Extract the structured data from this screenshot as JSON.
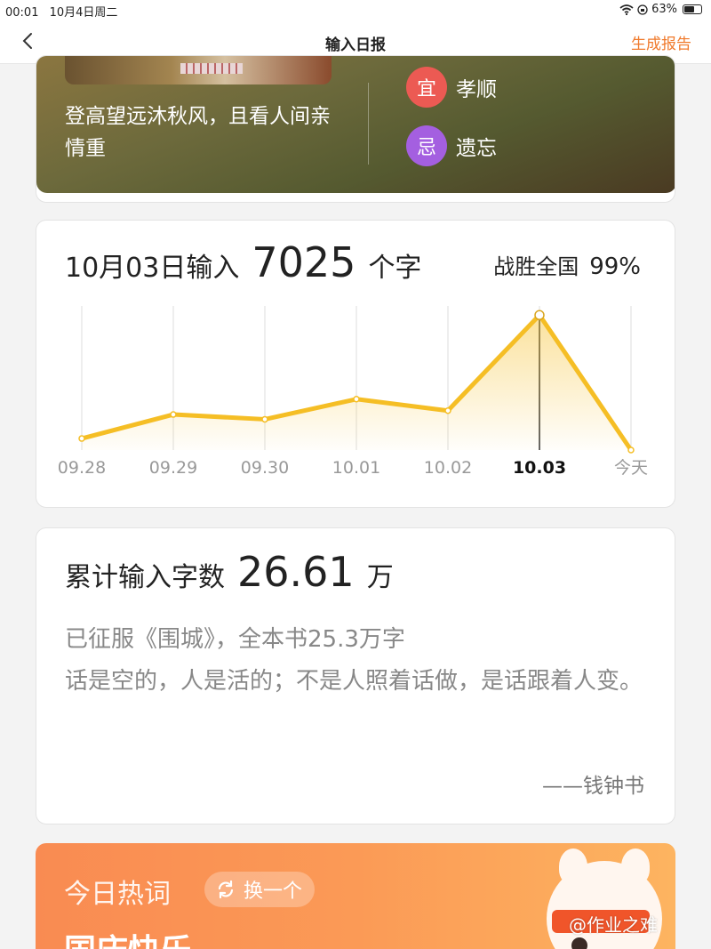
{
  "status_bar": {
    "time": "00:01",
    "date": "10月4日周二",
    "battery": "63%",
    "battery_level": 0.63
  },
  "nav": {
    "title": "输入日报",
    "action": "生成报告"
  },
  "banner": {
    "poem": "登高望远沐秋风，且看人间亲情重",
    "good_label": "宜",
    "good_value": "孝顺",
    "bad_label": "忌",
    "bad_value": "遗忘"
  },
  "daily": {
    "date_prefix": "10月03日输入",
    "count": "7025",
    "unit": "个字",
    "rank_label": "战胜全国",
    "rank_value": "99%"
  },
  "chart_data": {
    "type": "area",
    "categories": [
      "09.28",
      "09.29",
      "09.30",
      "10.01",
      "10.02",
      "10.03",
      "今天"
    ],
    "values": [
      600,
      1850,
      1600,
      2650,
      2050,
      7025,
      0
    ],
    "selected_index": 5,
    "ylim": [
      0,
      7500
    ],
    "grid": "vertical",
    "line_color": "#f5be25",
    "title": "",
    "xlabel": "",
    "ylabel": ""
  },
  "total": {
    "label": "累计输入字数",
    "value": "26.61",
    "unit": "万",
    "conquered": "已征服《围城》，全本书25.3万字",
    "quote": "话是空的，人是活的；不是人照着话做，是话跟着人变。",
    "author": "——钱钟书"
  },
  "hot": {
    "label": "今日热词",
    "refresh": "换一个",
    "word": "国庆快乐"
  },
  "watermark": "@作业之难"
}
